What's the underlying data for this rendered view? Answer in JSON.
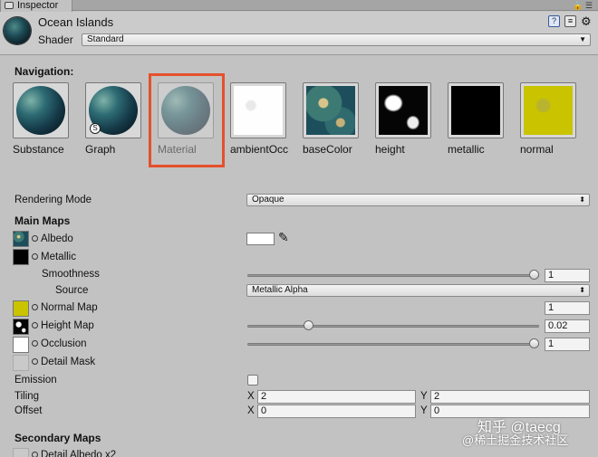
{
  "tab": {
    "label": "Inspector"
  },
  "header": {
    "title": "Ocean Islands",
    "shader_label": "Shader",
    "shader_value": "Standard"
  },
  "navigation": {
    "label": "Navigation:",
    "items": [
      {
        "label": "Substance"
      },
      {
        "label": "Graph"
      },
      {
        "label": "Material"
      },
      {
        "label": "ambientOcc"
      },
      {
        "label": "baseColor"
      },
      {
        "label": "height"
      },
      {
        "label": "metallic"
      },
      {
        "label": "normal"
      }
    ]
  },
  "props": {
    "rendering_mode_label": "Rendering Mode",
    "rendering_mode_value": "Opaque",
    "main_maps_label": "Main Maps",
    "albedo_label": "Albedo",
    "metallic_label": "Metallic",
    "smoothness_label": "Smoothness",
    "smoothness_value": "1",
    "source_label": "Source",
    "source_value": "Metallic Alpha",
    "normal_label": "Normal Map",
    "normal_value": "1",
    "height_label": "Height Map",
    "height_value": "0.02",
    "occlusion_label": "Occlusion",
    "occlusion_value": "1",
    "detail_mask_label": "Detail Mask",
    "emission_label": "Emission",
    "tiling_label": "Tiling",
    "tiling_x_label": "X",
    "tiling_x": "2",
    "tiling_y_label": "Y",
    "tiling_y": "2",
    "offset_label": "Offset",
    "offset_x_label": "X",
    "offset_x": "0",
    "offset_y_label": "Y",
    "offset_y": "0",
    "secondary_maps_label": "Secondary Maps",
    "detail_albedo_label": "Detail Albedo x2"
  },
  "sliders": {
    "smoothness": 1.0,
    "height": 0.2,
    "occlusion": 1.0
  },
  "watermark": {
    "line1": "知乎 @taecg",
    "line2": "@稀土掘金技术社区"
  },
  "colors": {
    "selection_highlight": "#e5502b",
    "albedo_color": "#ffffff",
    "normal_tint": "#c9c300"
  }
}
